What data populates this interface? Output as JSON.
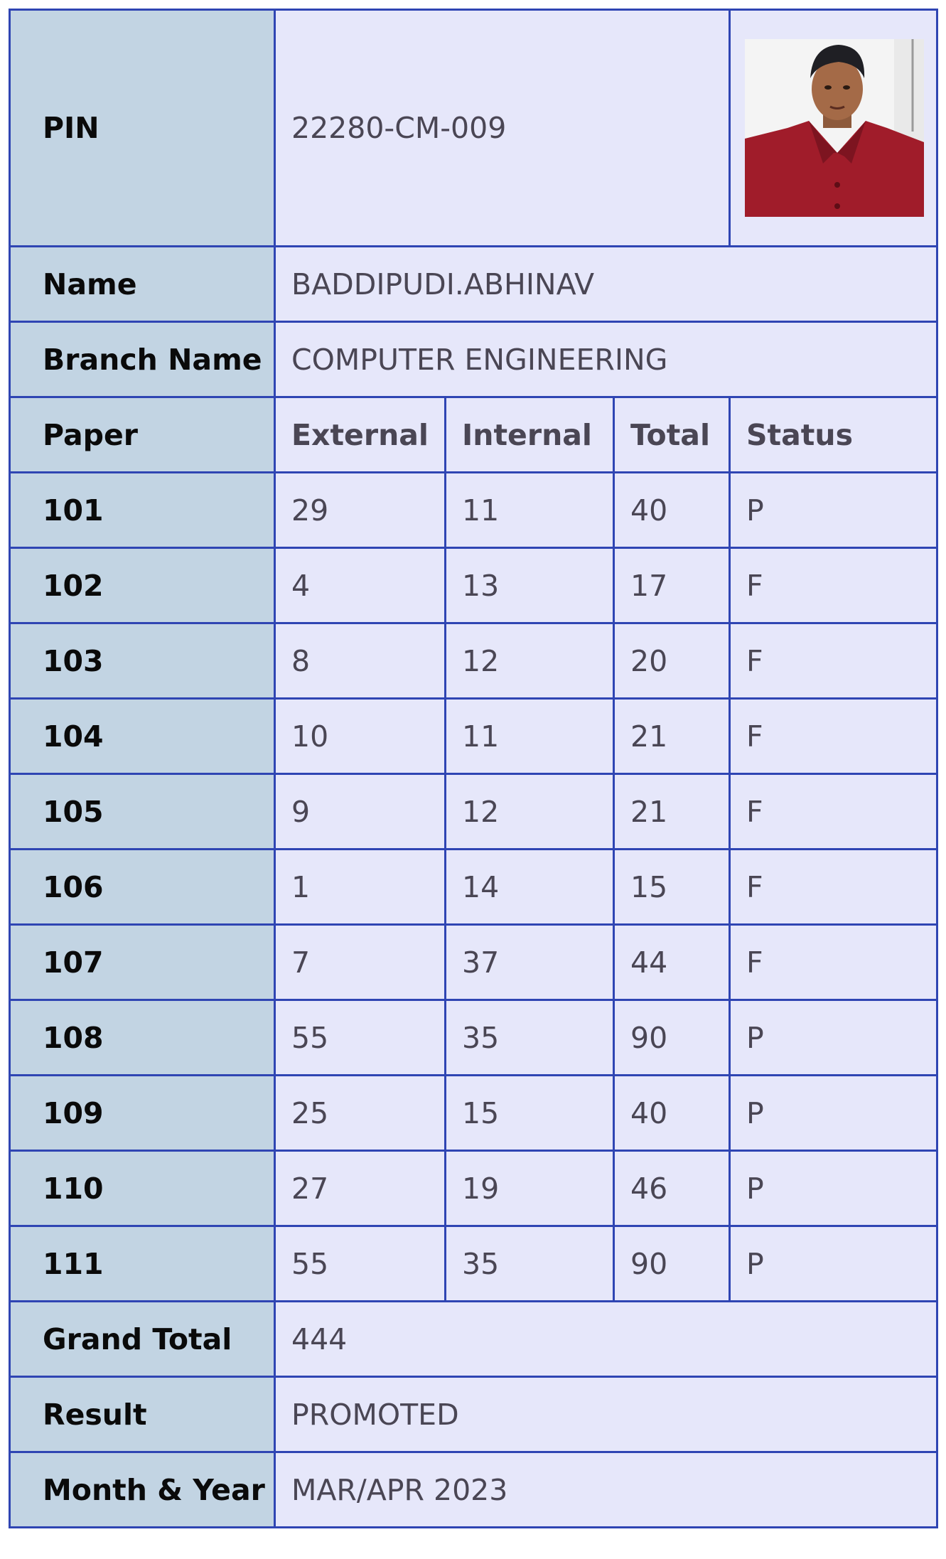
{
  "student": {
    "pin_label": "PIN",
    "pin": "22280-CM-009",
    "name_label": "Name",
    "name": "BADDIPUDI.ABHINAV",
    "branch_label": "Branch Name",
    "branch": "COMPUTER ENGINEERING"
  },
  "marks": {
    "headers": [
      "Paper",
      "External",
      "Internal",
      "Total",
      "Status"
    ],
    "rows": [
      {
        "paper": "101",
        "external": "29",
        "internal": "11",
        "total": "40",
        "status": "P"
      },
      {
        "paper": "102",
        "external": "4",
        "internal": "13",
        "total": "17",
        "status": "F"
      },
      {
        "paper": "103",
        "external": "8",
        "internal": "12",
        "total": "20",
        "status": "F"
      },
      {
        "paper": "104",
        "external": "10",
        "internal": "11",
        "total": "21",
        "status": "F"
      },
      {
        "paper": "105",
        "external": "9",
        "internal": "12",
        "total": "21",
        "status": "F"
      },
      {
        "paper": "106",
        "external": "1",
        "internal": "14",
        "total": "15",
        "status": "F"
      },
      {
        "paper": "107",
        "external": "7",
        "internal": "37",
        "total": "44",
        "status": "F"
      },
      {
        "paper": "108",
        "external": "55",
        "internal": "35",
        "total": "90",
        "status": "P"
      },
      {
        "paper": "109",
        "external": "25",
        "internal": "15",
        "total": "40",
        "status": "P"
      },
      {
        "paper": "110",
        "external": "27",
        "internal": "19",
        "total": "46",
        "status": "P"
      },
      {
        "paper": "111",
        "external": "55",
        "internal": "35",
        "total": "90",
        "status": "P"
      }
    ]
  },
  "summary": {
    "grand_total_label": "Grand Total",
    "grand_total": "444",
    "result_label": "Result",
    "result": "PROMOTED",
    "month_year_label": "Month & Year",
    "month_year": "MAR/APR 2023"
  },
  "colors": {
    "border": "#2f45b3",
    "label_bg": "#c2d4e3",
    "value_bg": "#e6e7fa",
    "value_text": "#4a4654"
  },
  "icons": {
    "photo": "student-photo"
  }
}
